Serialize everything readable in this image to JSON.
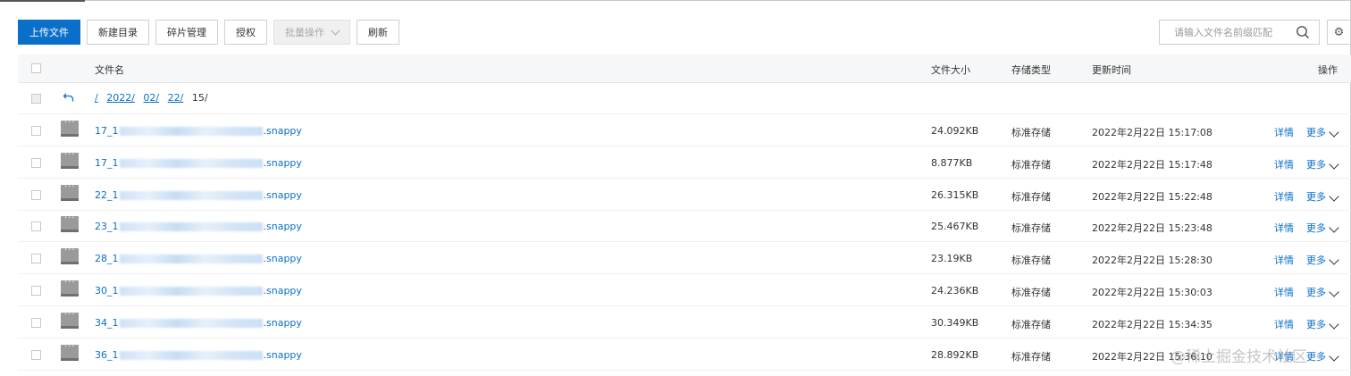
{
  "toolbar": {
    "upload_label": "上传文件",
    "new_dir_label": "新建目录",
    "fragments_label": "碎片管理",
    "auth_label": "授权",
    "batch_label": "批量操作",
    "refresh_label": "刷新"
  },
  "search": {
    "placeholder": "请输入文件名前缀匹配",
    "icon": "search-icon"
  },
  "settings": {
    "icon": "gear-icon"
  },
  "table": {
    "headers": {
      "name": "文件名",
      "size": "文件大小",
      "storage": "存储类型",
      "updated": "更新时间",
      "actions": "操作"
    },
    "breadcrumb": {
      "root": "/",
      "p1": "2022/",
      "p2": "02/",
      "p3": "22/",
      "current": "15/"
    },
    "rows": [
      {
        "name_prefix": "17_1",
        "name_suffix": ".snappy",
        "size": "24.092KB",
        "storage": "标准存储",
        "updated": "2022年2月22日 15:17:08",
        "detail": "详情",
        "more": "更多"
      },
      {
        "name_prefix": "17_1",
        "name_suffix": ".snappy",
        "size": "8.877KB",
        "storage": "标准存储",
        "updated": "2022年2月22日 15:17:48",
        "detail": "详情",
        "more": "更多"
      },
      {
        "name_prefix": "22_1",
        "name_suffix": ".snappy",
        "size": "26.315KB",
        "storage": "标准存储",
        "updated": "2022年2月22日 15:22:48",
        "detail": "详情",
        "more": "更多"
      },
      {
        "name_prefix": "23_1",
        "name_suffix": ".snappy",
        "size": "25.467KB",
        "storage": "标准存储",
        "updated": "2022年2月22日 15:23:48",
        "detail": "详情",
        "more": "更多"
      },
      {
        "name_prefix": "28_1",
        "name_suffix": ".snappy",
        "size": "23.19KB",
        "storage": "标准存储",
        "updated": "2022年2月22日 15:28:30",
        "detail": "详情",
        "more": "更多"
      },
      {
        "name_prefix": "30_1",
        "name_suffix": ".snappy",
        "size": "24.236KB",
        "storage": "标准存储",
        "updated": "2022年2月22日 15:30:03",
        "detail": "详情",
        "more": "更多"
      },
      {
        "name_prefix": "34_1",
        "name_suffix": ".snappy",
        "size": "30.349KB",
        "storage": "标准存储",
        "updated": "2022年2月22日 15:34:35",
        "detail": "详情",
        "more": "更多"
      },
      {
        "name_prefix": "36_1",
        "name_suffix": ".snappy",
        "size": "28.892KB",
        "storage": "标准存储",
        "updated": "2022年2月22日 15:36:10",
        "detail": "详情",
        "more": "更多"
      }
    ]
  },
  "watermark": "@稀土掘金技术社区",
  "colors": {
    "primary": "#0a6fc9",
    "header_bg": "#f6f7f8",
    "file_icon": "#9a9a9a"
  }
}
